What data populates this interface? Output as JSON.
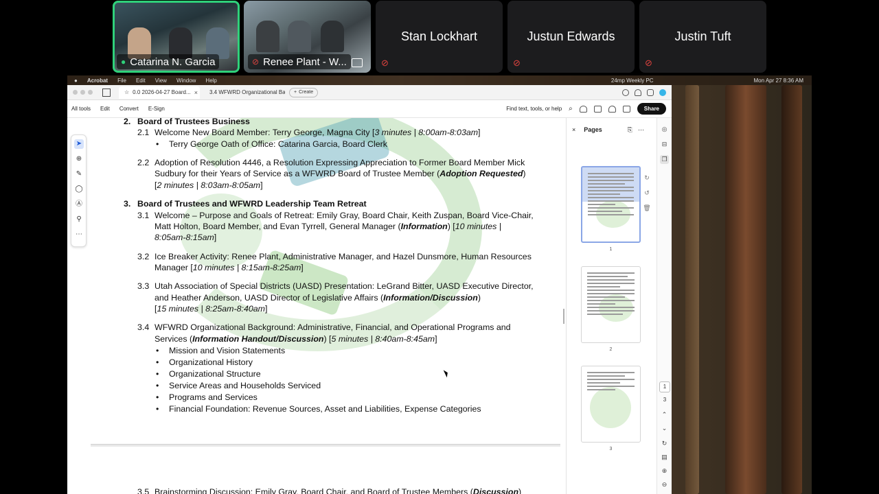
{
  "participants": [
    {
      "name": "Catarina N. Garcia",
      "video": true,
      "active": true
    },
    {
      "name": "Renee Plant - W...",
      "video": true,
      "active": false
    },
    {
      "name": "Stan Lockhart",
      "video": false
    },
    {
      "name": "Justun Edwards",
      "video": false
    },
    {
      "name": "Justin Tuft",
      "video": false
    }
  ],
  "mac_menubar": {
    "app": "Acrobat",
    "items": [
      "File",
      "Edit",
      "View",
      "Window",
      "Help"
    ],
    "meeting_label": "24mp Weekly PC",
    "clock": "Mon Apr 27  8:36 AM"
  },
  "acrobat": {
    "tabs": [
      {
        "label": "0.0 2026-04-27 Board...",
        "active": true
      },
      {
        "label": "3.4 WFWRD Organizational Ba...",
        "active": false
      }
    ],
    "create_label": "Create",
    "menu": [
      "All tools",
      "Edit",
      "Convert",
      "E-Sign"
    ],
    "find_label": "Find text, tools, or help",
    "share_label": "Share"
  },
  "document": {
    "section2": {
      "num": "2.",
      "title": "Board of Trustees Business"
    },
    "item_2_1": {
      "num": "2.1",
      "text": "Welcome New Board Member: Terry George, Magna City [",
      "time": "3 minutes | 8:00am-8:03am",
      "close": "]"
    },
    "item_2_1_bullet": "Terry George Oath of Office: Catarina Garcia, Board Clerk",
    "item_2_2": {
      "num": "2.2",
      "line1": "Adoption of Resolution 4446, a Resolution Expressing Appreciation to Former Board Member Mick",
      "line2_pre": "Sudbury for their Years of Service as a WFWRD Board of Trustee Member (",
      "line2_em": "Adoption Requested",
      "line2_post": ")",
      "line3_time": "2 minutes | 8:03am-8:05am"
    },
    "section3": {
      "num": "3.",
      "title": "Board of Trustees and WFWRD Leadership Team Retreat"
    },
    "item_3_1": {
      "num": "3.1",
      "line1": "Welcome – Purpose and Goals of Retreat: Emily Gray, Board Chair, Keith Zuspan, Board Vice-Chair,",
      "line2_pre": "Matt Holton, Board Member, and Evan Tyrrell, General Manager (",
      "line2_em": "Information",
      "line2_post": ") [",
      "line2_time": "10 minutes |",
      "line3_time": "8:05am-8:15am"
    },
    "item_3_2": {
      "num": "3.2",
      "line1": "Ice Breaker Activity: Renee Plant, Administrative Manager, and Hazel Dunsmore, Human Resources",
      "line2_pre": "Manager [",
      "line2_time": "10 minutes | 8:15am-8:25am"
    },
    "item_3_3": {
      "num": "3.3",
      "line1": "Utah Association of Special Districts (UASD) Presentation: LeGrand Bitter, UASD Executive Director,",
      "line2_pre": "and Heather Anderson, UASD Director of Legislative Affairs (",
      "line2_em": "Information/Discussion",
      "line2_post": ")",
      "line3_time": "15 minutes | 8:25am-8:40am"
    },
    "item_3_4": {
      "num": "3.4",
      "line1": "WFWRD Organizational Background: Administrative, Financial, and Operational Programs and",
      "line2_pre": "Services (",
      "line2_em": "Information Handout/Discussion",
      "line2_post": ") [",
      "line2_time": "5 minutes | 8:40am-8:45am"
    },
    "item_3_4_bullets": [
      "Mission and Vision Statements",
      "Organizational History",
      "Organizational Structure",
      "Service Areas and Households Serviced",
      "Programs and Services",
      "Financial Foundation: Revenue Sources, Asset and Liabilities, Expense Categories"
    ],
    "item_3_5_partial": {
      "num": "3.5",
      "text": "Brainstorming Discussion: Emily Gray, Board Chair, and Board of Trustee Members (",
      "em": "Discussion",
      "close": ")"
    }
  },
  "pages_panel": {
    "title": "Pages",
    "thumbnails": [
      {
        "label": "1",
        "selected": true
      },
      {
        "label": "2",
        "selected": false
      },
      {
        "label": "3",
        "selected": false
      }
    ],
    "current_page": "1",
    "total_pages": "3"
  }
}
